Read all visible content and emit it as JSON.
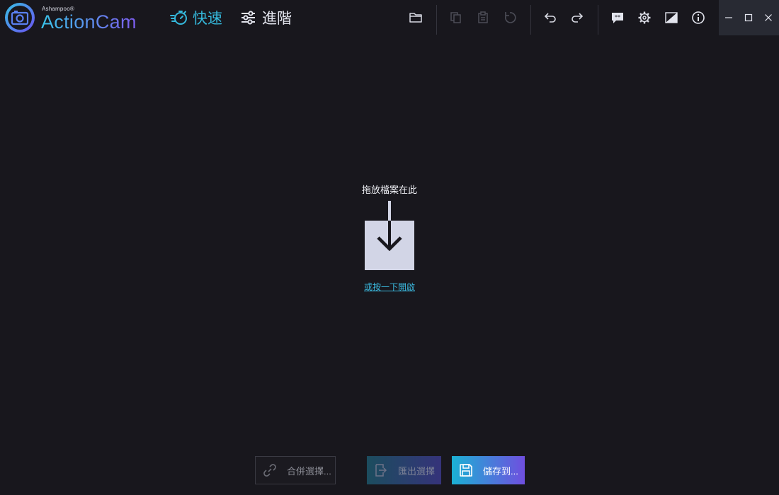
{
  "app": {
    "brand_small": "Ashampoo®",
    "brand_name": "ActionCam"
  },
  "modes": {
    "quick_label": "快速",
    "advanced_label": "進階",
    "active": "quick"
  },
  "toolbar": {
    "icons": [
      "folder-icon",
      "copy-icon",
      "paste-icon",
      "reset-icon",
      "undo-icon",
      "redo-icon",
      "feedback-icon",
      "settings-icon",
      "display-icon",
      "info-icon"
    ]
  },
  "window_controls": {
    "icons": [
      "minimize-icon",
      "maximize-icon",
      "close-icon"
    ]
  },
  "drop": {
    "label": "拖放檔案在此",
    "open_link": "或按一下開啟"
  },
  "actions": {
    "merge_label": "合併選擇...",
    "export_label": "匯出選擇",
    "save_label": "儲存到..."
  },
  "colors": {
    "background": "#18171d",
    "accent_cyan": "#35b9dc",
    "accent_purple": "#6f4fdf",
    "drop_tile": "#d2d5e6"
  }
}
